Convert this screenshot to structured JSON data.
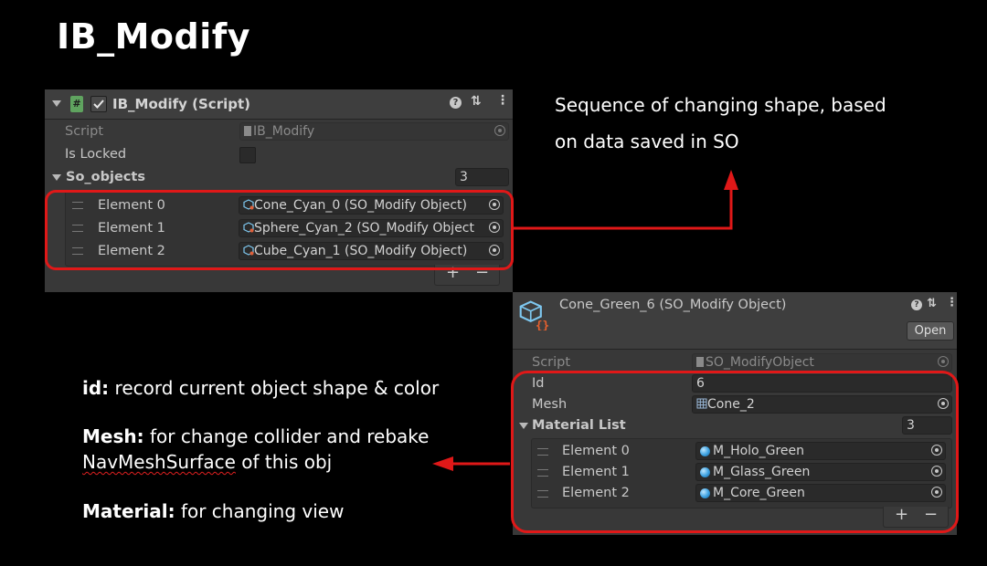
{
  "slide": {
    "title": "IB_Modify"
  },
  "script_panel": {
    "header_title": "IB_Modify (Script)",
    "enabled": true,
    "script_label": "Script",
    "script_value": "IB_Modify",
    "is_locked_label": "Is Locked",
    "is_locked": false,
    "list_label": "So_objects",
    "list_size": "3",
    "elements": [
      {
        "label": "Element 0",
        "value": "Cone_Cyan_0 (SO_Modify Object)"
      },
      {
        "label": "Element 1",
        "value": "Sphere_Cyan_2 (SO_Modify Object"
      },
      {
        "label": "Element 2",
        "value": "Cube_Cyan_1 (SO_Modify Object)"
      }
    ],
    "add_label": "+",
    "remove_label": "−"
  },
  "so_panel": {
    "header_title": "Cone_Green_6 (SO_Modify Object)",
    "open_label": "Open",
    "script_label": "Script",
    "script_value": "SO_ModifyObject",
    "id_label": "Id",
    "id_value": "6",
    "mesh_label": "Mesh",
    "mesh_value": "Cone_2",
    "list_label": "Material List",
    "list_size": "3",
    "elements": [
      {
        "label": "Element 0",
        "value": "M_Holo_Green"
      },
      {
        "label": "Element 1",
        "value": "M_Glass_Green"
      },
      {
        "label": "Element 2",
        "value": "M_Core_Green"
      }
    ],
    "add_label": "+",
    "remove_label": "−"
  },
  "annotations": {
    "top_right": [
      "Sequence of changing shape, based",
      "on data saved in SO"
    ],
    "id_key": "id:",
    "id_text": " record current object shape & color",
    "mesh_key": "Mesh:",
    "mesh_text": " for change collider and rebake",
    "mesh_word": "NavMeshSurface",
    "mesh_tail": " of this obj",
    "material_key": "Material:",
    "material_text": " for changing view"
  },
  "colors": {
    "background": "#000000",
    "highlight": "#e01818",
    "panel": "#383838"
  }
}
